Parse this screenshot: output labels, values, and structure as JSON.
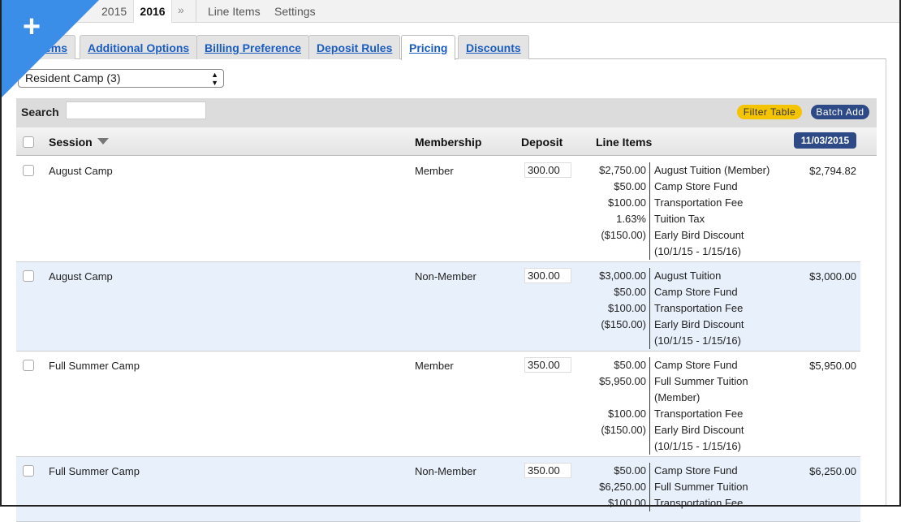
{
  "topbar": {
    "years": [
      "2015",
      "2016"
    ],
    "more": "»",
    "links": [
      "Line Items",
      "Settings"
    ]
  },
  "tabs": [
    {
      "label": "Items"
    },
    {
      "label": "Additional Options"
    },
    {
      "label": "Billing Preference"
    },
    {
      "label": "Deposit Rules"
    },
    {
      "label": "Pricing"
    },
    {
      "label": "Discounts"
    }
  ],
  "program_select": {
    "value": "Resident Camp (3)"
  },
  "search": {
    "label": "Search",
    "value": ""
  },
  "buttons": {
    "filter": "Filter Table",
    "batch_add": "Batch Add"
  },
  "table": {
    "headers": {
      "session": "Session",
      "membership": "Membership",
      "deposit": "Deposit",
      "line_items": "Line Items",
      "date": "11/03/2015"
    },
    "rows": [
      {
        "session": "August Camp",
        "membership": "Member",
        "deposit": "300.00",
        "total": "$2,794.82",
        "amounts": [
          "$2,750.00",
          "$50.00",
          "$100.00",
          "1.63%",
          "($150.00)",
          ""
        ],
        "items": [
          "August Tuition (Member)",
          "Camp Store Fund",
          "Transportation Fee",
          "Tuition Tax",
          "Early Bird Discount",
          "(10/1/15 - 1/15/16)"
        ]
      },
      {
        "session": "August Camp",
        "membership": "Non-Member",
        "deposit": "300.00",
        "total": "$3,000.00",
        "amounts": [
          "$3,000.00",
          "$50.00",
          "$100.00",
          "($150.00)",
          ""
        ],
        "items": [
          "August Tuition",
          "Camp Store Fund",
          "Transportation Fee",
          "Early Bird Discount",
          "(10/1/15 - 1/15/16)"
        ]
      },
      {
        "session": "Full Summer Camp",
        "membership": "Member",
        "deposit": "350.00",
        "total": "$5,950.00",
        "amounts": [
          "$50.00",
          "$5,950.00",
          "",
          "$100.00",
          "($150.00)",
          ""
        ],
        "items": [
          "Camp Store Fund",
          "Full Summer Tuition",
          "(Member)",
          "Transportation Fee",
          "Early Bird Discount",
          "(10/1/15 - 1/15/16)"
        ]
      },
      {
        "session": "Full Summer Camp",
        "membership": "Non-Member",
        "deposit": "350.00",
        "total": "$6,250.00",
        "amounts": [
          "$50.00",
          "$6,250.00",
          "$100.00"
        ],
        "items": [
          "Camp Store Fund",
          "Full Summer Tuition",
          "Transportation Fee"
        ]
      }
    ]
  },
  "colors": {
    "accent": "#3b8ee8",
    "tab_link": "#1a5cbf",
    "filter_button": "#f5c400",
    "navy": "#2d4a86",
    "alt_row": "#e8f0fb"
  }
}
